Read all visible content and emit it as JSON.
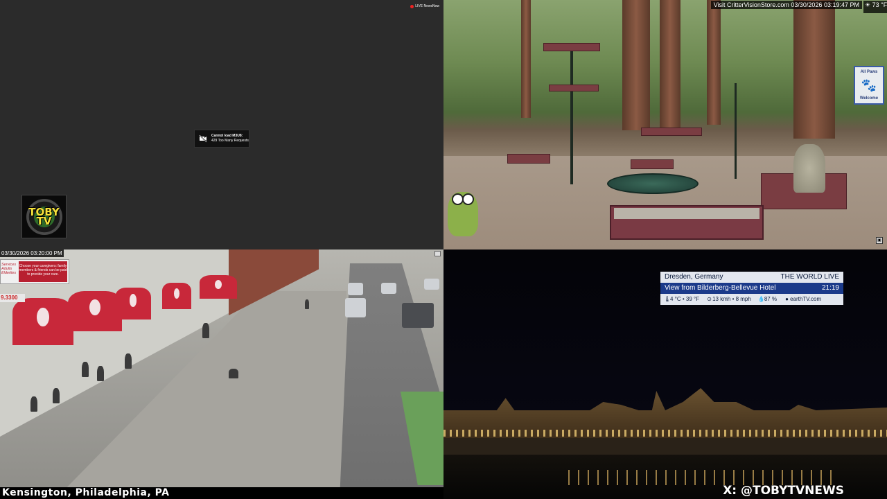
{
  "top_left": {
    "live_badge": "LIVE NewsNow",
    "error": {
      "title": "Cannot load M3U8:",
      "message": "429 Too Many Requests"
    },
    "logo_text": "TOBY TV"
  },
  "top_right": {
    "banner": "Visit CritterVisionStore.com 03/30/2026 03:19:47 PM",
    "temperature": "73 °F",
    "sign_top": "All Paws",
    "sign_bottom": "Welcome"
  },
  "bottom_left": {
    "timestamp": "03/30/2026 03:20:00 PM",
    "sign_side": "Services Adults Elderlies",
    "sign_main": "Choose your caregivers: family members & friends can be paid to provide your care.",
    "price": "9.3300",
    "location": "Kensington, Philadelphia, PA"
  },
  "bottom_right": {
    "city": "Dresden, Germany",
    "brand": "THE WORLD LIVE",
    "view": "View from Bilderberg-Bellevue Hotel",
    "time": "21:19",
    "temp": "4 °C • 39 °F",
    "wind": "13 kmh • 8 mph",
    "humidity": "87 %",
    "source": "earthTV.com",
    "x_handle": "X: @TOBYTVNEWS"
  }
}
